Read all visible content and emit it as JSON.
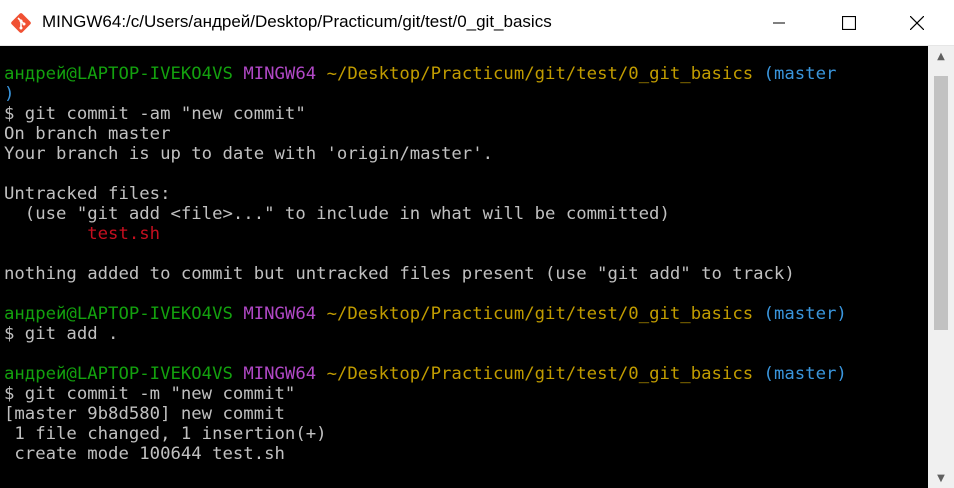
{
  "window": {
    "title": "MINGW64:/c/Users/андрей/Desktop/Practicum/git/test/0_git_basics",
    "icons": [
      "git-logo-icon",
      "minimize-icon",
      "maximize-icon",
      "close-icon"
    ],
    "colors": {
      "user": "#13a10e",
      "mingw": "#b148c6",
      "path": "#c19c00",
      "branch": "#3a96dd",
      "untracked_file": "#c50f1f",
      "text": "#c0c0c0"
    }
  },
  "terminal": {
    "prompt1": {
      "user": "андрей@LAPTOP-IVEKO4VS",
      "shell": "MINGW64",
      "path": "~/Desktop/Practicum/git/test/0_git_basics",
      "branch_open": "(master",
      "branch_close": ")"
    },
    "cmd1": "$ git commit -am \"new commit\"",
    "out1": "On branch master",
    "out2": "Your branch is up to date with 'origin/master'.",
    "out3": "Untracked files:",
    "out4": "  (use \"git add <file>...\" to include in what will be committed)",
    "out5": "        test.sh",
    "out6": "nothing added to commit but untracked files present (use \"git add\" to track)",
    "prompt2": {
      "user": "андрей@LAPTOP-IVEKO4VS",
      "shell": "MINGW64",
      "path": "~/Desktop/Practicum/git/test/0_git_basics",
      "branch": "(master)"
    },
    "cmd2": "$ git add .",
    "prompt3": {
      "user": "андрей@LAPTOP-IVEKO4VS",
      "shell": "MINGW64",
      "path": "~/Desktop/Practicum/git/test/0_git_basics",
      "branch": "(master)"
    },
    "cmd3": "$ git commit -m \"new commit\"",
    "out7": "[master 9b8d580] new commit",
    "out8": " 1 file changed, 1 insertion(+)",
    "out9": " create mode 100644 test.sh"
  }
}
